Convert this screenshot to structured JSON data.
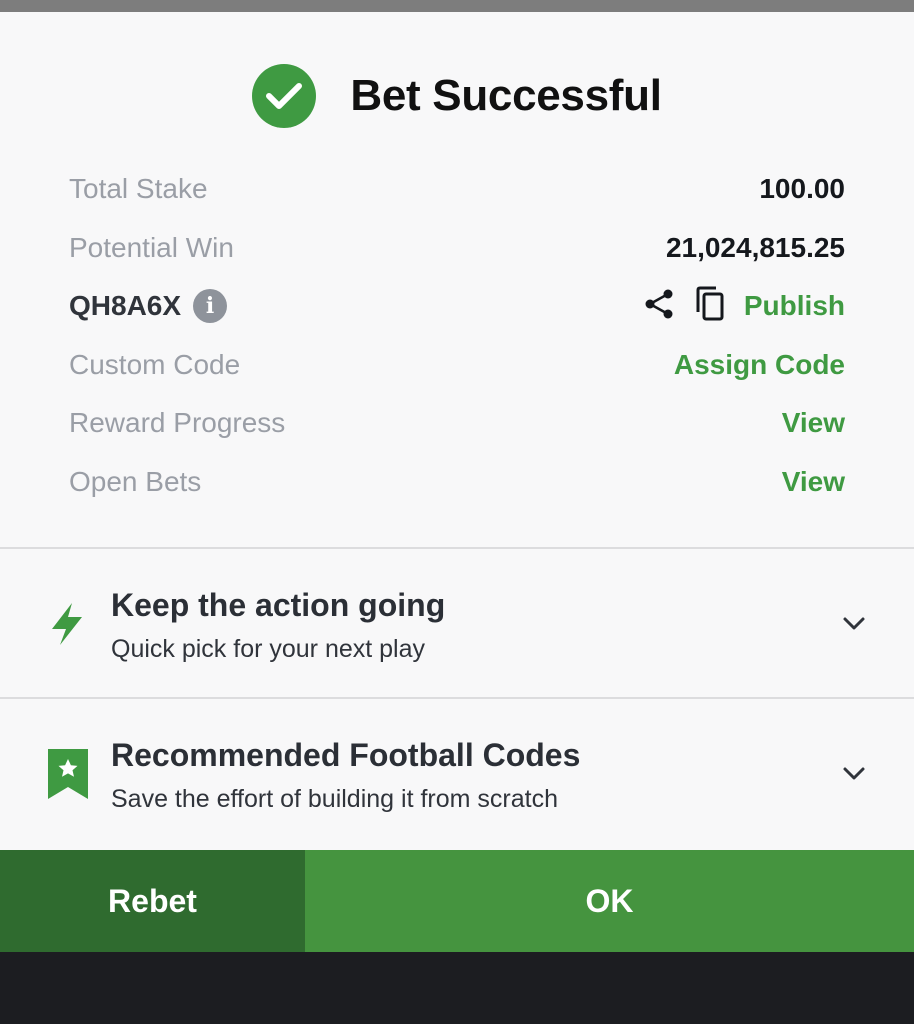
{
  "header": {
    "title": "Bet Successful"
  },
  "details": {
    "total_stake": {
      "label": "Total Stake",
      "value": "100.00"
    },
    "potential_win": {
      "label": "Potential Win",
      "value": "21,024,815.25"
    },
    "booking": {
      "code": "QH8A6X",
      "info_glyph": "i",
      "publish_label": "Publish"
    },
    "custom_code": {
      "label": "Custom Code",
      "action": "Assign Code"
    },
    "reward_progress": {
      "label": "Reward Progress",
      "action": "View"
    },
    "open_bets": {
      "label": "Open Bets",
      "action": "View"
    }
  },
  "sections": {
    "quick_pick": {
      "title": "Keep the action going",
      "subtitle": "Quick pick for your next play"
    },
    "recommended": {
      "title": "Recommended Football Codes",
      "subtitle": "Save the effort of building it from scratch"
    }
  },
  "buttons": {
    "rebet": "Rebet",
    "ok": "OK"
  },
  "colors": {
    "accent": "#3f9a42",
    "rebet_bg": "#2f6b2f",
    "ok_bg": "#45943f",
    "muted_text": "#9a9ea6"
  },
  "icons": [
    "check-circle-icon",
    "info-icon",
    "share-icon",
    "copy-icon",
    "lightning-icon",
    "bookmark-star-icon",
    "chevron-down-icon"
  ]
}
